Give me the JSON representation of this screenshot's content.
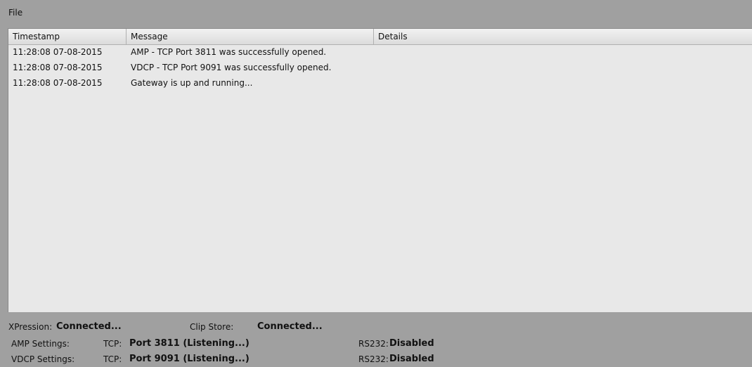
{
  "menu": {
    "file": "File"
  },
  "log": {
    "columns": {
      "timestamp": "Timestamp",
      "message": "Message",
      "details": "Details"
    },
    "rows": [
      {
        "timestamp": "11:28:08  07-08-2015",
        "message": "AMP - TCP Port 3811 was successfully opened.",
        "details": ""
      },
      {
        "timestamp": "11:28:08  07-08-2015",
        "message": "VDCP - TCP Port 9091 was successfully opened.",
        "details": ""
      },
      {
        "timestamp": "11:28:08  07-08-2015",
        "message": "Gateway is up and running...",
        "details": ""
      }
    ]
  },
  "status": {
    "xpression_label": "XPression:",
    "xpression_value": "Connected...",
    "clipstore_label": "Clip Store:",
    "clipstore_value": "Connected...",
    "amp_label": "AMP Settings:",
    "amp_tcp_label": "TCP:",
    "amp_tcp_value": "Port 3811 (Listening...)",
    "amp_rs232_label": "RS232:",
    "amp_rs232_value": "Disabled",
    "vdcp_label": "VDCP Settings:",
    "vdcp_tcp_label": "TCP:",
    "vdcp_tcp_value": "Port 9091 (Listening...)",
    "vdcp_rs232_label": "RS232:",
    "vdcp_rs232_value": "Disabled"
  }
}
